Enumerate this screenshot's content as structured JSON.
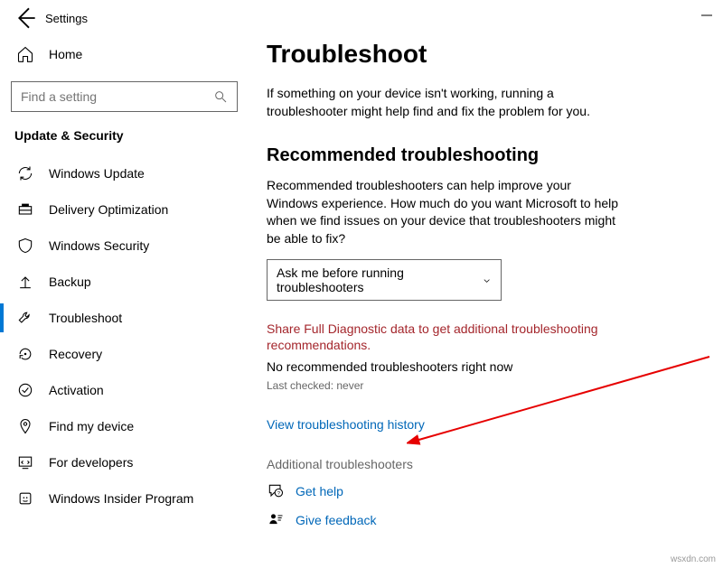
{
  "app": {
    "title": "Settings"
  },
  "sidebar": {
    "home": "Home",
    "search_placeholder": "Find a setting",
    "section_title": "Update & Security",
    "items": [
      {
        "label": "Windows Update"
      },
      {
        "label": "Delivery Optimization"
      },
      {
        "label": "Windows Security"
      },
      {
        "label": "Backup"
      },
      {
        "label": "Troubleshoot"
      },
      {
        "label": "Recovery"
      },
      {
        "label": "Activation"
      },
      {
        "label": "Find my device"
      },
      {
        "label": "For developers"
      },
      {
        "label": "Windows Insider Program"
      }
    ]
  },
  "main": {
    "title": "Troubleshoot",
    "intro": "If something on your device isn't working, running a troubleshooter might help find and fix the problem for you.",
    "rec_title": "Recommended troubleshooting",
    "rec_text": "Recommended troubleshooters can help improve your Windows experience. How much do you want Microsoft to help when we find issues on your device that troubleshooters might be able to fix?",
    "dropdown_value": "Ask me before running troubleshooters",
    "warning": "Share Full Diagnostic data to get additional troubleshooting recommendations.",
    "no_recommended": "No recommended troubleshooters right now",
    "last_checked": "Last checked: never",
    "history_link": "View troubleshooting history",
    "additional": "Additional troubleshooters",
    "get_help": "Get help",
    "give_feedback": "Give feedback"
  },
  "watermark": "wsxdn.com"
}
